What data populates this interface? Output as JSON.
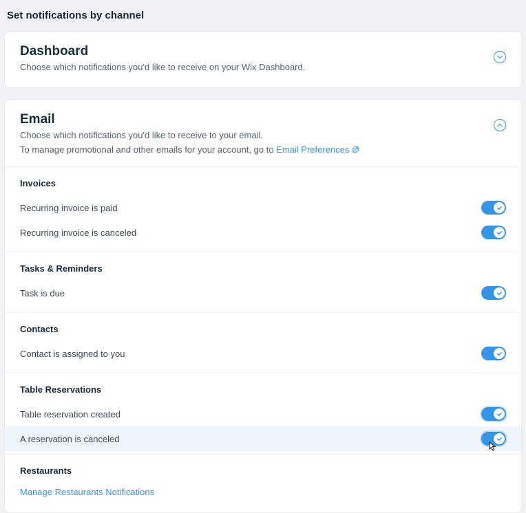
{
  "page": {
    "title": "Set notifications by channel"
  },
  "dashboard": {
    "title": "Dashboard",
    "desc": "Choose which notifications you'd like to receive on your Wix Dashboard."
  },
  "email": {
    "title": "Email",
    "desc1": "Choose which notifications you'd like to receive to your email.",
    "desc2_pre": "To manage promotional and other emails for your account, go to ",
    "desc2_link": "Email Preferences"
  },
  "sections": {
    "invoices": {
      "title": "Invoices",
      "items": [
        {
          "label": "Recurring invoice is paid"
        },
        {
          "label": "Recurring invoice is canceled"
        }
      ]
    },
    "tasks": {
      "title": "Tasks & Reminders",
      "items": [
        {
          "label": "Task is due"
        }
      ]
    },
    "contacts": {
      "title": "Contacts",
      "items": [
        {
          "label": "Contact is assigned to you"
        }
      ]
    },
    "table": {
      "title": "Table Reservations",
      "items": [
        {
          "label": "Table reservation created"
        },
        {
          "label": "A reservation is canceled"
        }
      ]
    },
    "restaurants": {
      "title": "Restaurants",
      "manage_link": "Manage Restaurants Notifications"
    }
  }
}
